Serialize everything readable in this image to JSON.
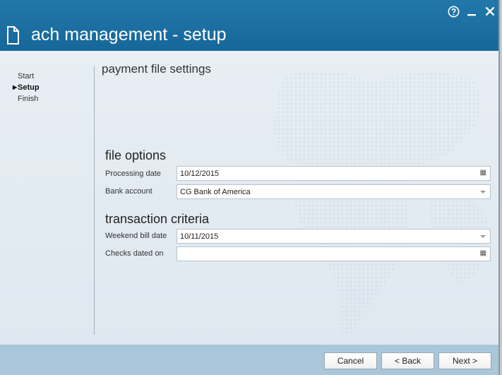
{
  "window": {
    "title": "ach management - setup",
    "controls": [
      "help-icon",
      "minimize-icon",
      "close-icon"
    ]
  },
  "steps": [
    {
      "label": "Start",
      "active": false
    },
    {
      "label": "Setup",
      "active": true
    },
    {
      "label": "Finish",
      "active": false
    }
  ],
  "page": {
    "heading": "payment file settings"
  },
  "file_options": {
    "title": "file options",
    "processing_date": {
      "label": "Processing date",
      "value": "10/12/2015",
      "icon": "calendar-icon"
    },
    "bank_account": {
      "label": "Bank account",
      "value": "CG Bank of America",
      "icon": "dropdown-arrow-icon"
    }
  },
  "transaction_criteria": {
    "title": "transaction criteria",
    "weekend_bill_date": {
      "label": "Weekend bill date",
      "value": "10/11/2015",
      "icon": "dropdown-arrow-icon"
    },
    "checks_dated_on": {
      "label": "Checks dated on",
      "value": "",
      "icon": "calendar-icon"
    }
  },
  "footer": {
    "cancel_label": "Cancel",
    "back_label": "< Back",
    "next_label": "Next >"
  }
}
